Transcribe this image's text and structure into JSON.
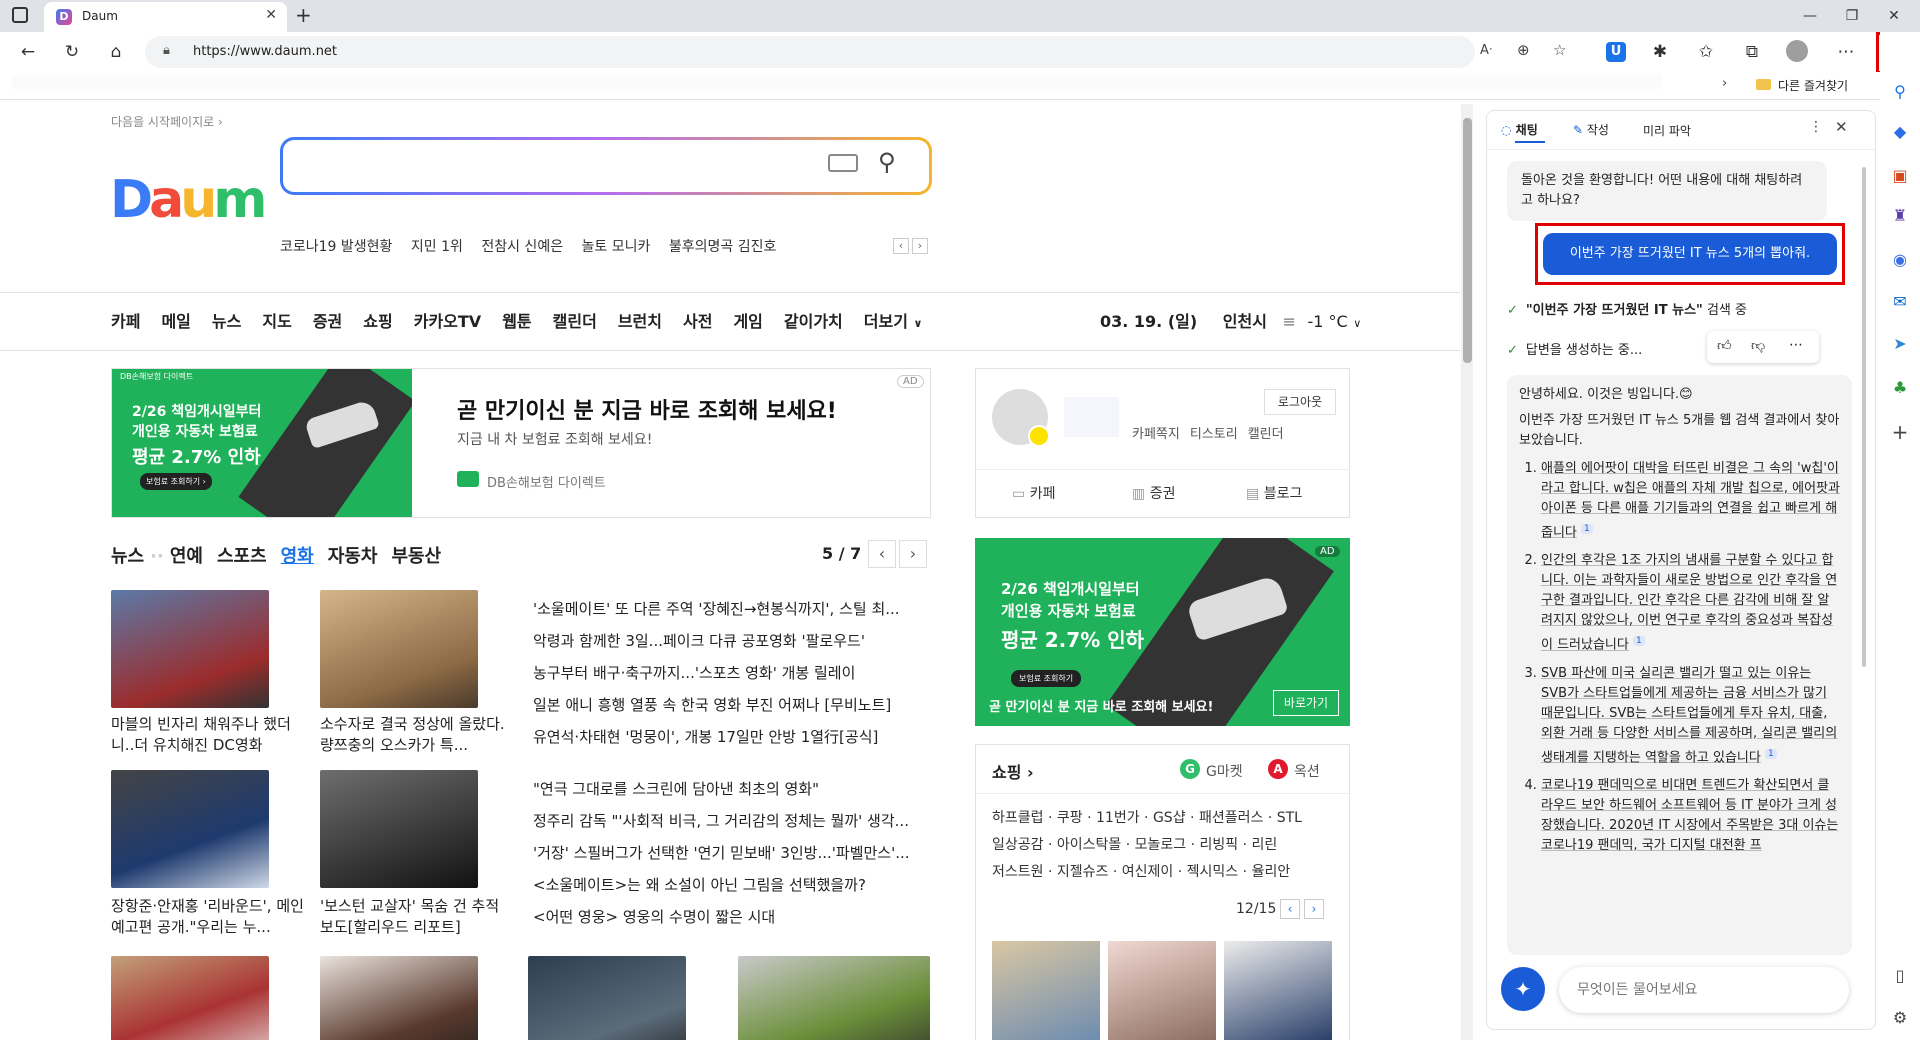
{
  "browser": {
    "tab_title": "Daum",
    "tab_icon": "D",
    "url": "https://www.daum.net",
    "fav_folder": "다른 즐겨찾기",
    "reading_icon": "Ȃ"
  },
  "daum": {
    "start_page": "다음을 시작페이지로",
    "logo": [
      "D",
      "a",
      "u",
      "m"
    ],
    "trending": [
      "코로나19 발생현황",
      "지민 1위",
      "전참시 신예은",
      "놀토 모니카",
      "불후의명곡 김진호"
    ],
    "nav": [
      "카페",
      "메일",
      "뉴스",
      "지도",
      "증권",
      "쇼핑",
      "카카오TV",
      "웹툰",
      "캘린더",
      "브런치",
      "사전",
      "게임",
      "같이가치",
      "더보기"
    ],
    "date": "03. 19. (일)",
    "location": "인천시",
    "temp": "-1 °C",
    "ad_main": {
      "badge": "AD",
      "headline": "곧 만기이신 분 지금 바로 조회해 보세요!",
      "sub": "지금 내 차 보험료 조회해 보세요!",
      "advertiser": "DB손해보험 다이렉트",
      "banner_top": "DB손해보험 다이렉트",
      "banner_line1": "2/26 책임개시일부터",
      "banner_line2": "개인용 자동차 보험료",
      "banner_line3": "평균 2.7% 인하",
      "banner_cta": "보험료 조회하기 ›"
    },
    "news_tabs": [
      "뉴스",
      "연예",
      "스포츠",
      "영화",
      "자동차",
      "부동산"
    ],
    "news_page": "5 / 7",
    "news_captions": [
      "마블의 빈자리 채워주나 했더니..더 유치해진 DC영화",
      "소수자로 결국 정상에 올랐다. 량쯔충의 오스카가 특...",
      "장항준·안재홍 '리바운드', 메인 예고편 공개.\"우리는 누...",
      "'보스턴 교살자' 목숨 건 추적 보도[할리우드 리포트]"
    ],
    "headlines_a": [
      "'소울메이트' 또 다른 주역 '장혜진→현봉식까지', 스틸 최...",
      "악령과 함께한 3일...페이크 다큐 공포영화 '팔로우드'",
      "농구부터 배구·축구까지...'스포츠 영화' 개봉 릴레이",
      "일본 애니 흥행 열풍 속 한국 영화 부진 어쩌나 [무비노트]",
      "유연석·차태현 '멍뭉이', 개봉 17일만 안방 1열行[공식]"
    ],
    "headlines_b": [
      "\"연극 그대로를 스크린에 담아낸 최초의 영화\"",
      "정주리 감독 \"'사회적 비극, 그 거리감의 정체는 뭘까' 생각...",
      "'거장' 스필버그가 선택한 '연기 믿보배' 3인방...'파벨만스'...",
      "<소울메이트>는 왜 소설이 아닌  그림을 선택했을까?",
      "<어떤 영웅> 영웅의 수명이 짧은 시대"
    ],
    "profile": {
      "logout": "로그아웃",
      "links": [
        "카페쪽지",
        "티스토리",
        "캘린더"
      ],
      "quick": [
        "카페",
        "증권",
        "블로그"
      ]
    },
    "ad_side": {
      "badge": "AD",
      "line1": "2/26 책임개시일부터",
      "line2": "개인용 자동차 보험료",
      "line3": "평균 2.7% 인하",
      "cta_small": "보험료 조회하기",
      "headline": "곧 만기이신 분 지금 바로 조회해 보세요!",
      "go": "바로가기"
    },
    "shopping": {
      "title": "쇼핑",
      "gmarket": "G마켓",
      "auction": "옥션",
      "rows": [
        [
          "하프클럽",
          "쿠팡",
          "11번가",
          "GS샵",
          "패션플러스",
          "STL"
        ],
        [
          "일상공감",
          "아이스탁몰",
          "모놀로그",
          "리빙픽",
          "리린"
        ],
        [
          "저스트원",
          "지젤슈즈",
          "여신제이",
          "젝시믹스",
          "율리안"
        ]
      ],
      "page": "12/15"
    }
  },
  "copilot": {
    "tabs": [
      "채팅",
      "작성",
      "미리 파악"
    ],
    "greeting": "돌아온 것을 환영합니다! 어떤 내용에 대해 채팅하려고 하나요?",
    "user_msg": "이번주 가장 뜨거웠던 IT 뉴스 5개의 뽑아줘.",
    "status1_bold": "\"이번주 가장 뜨거웠던 IT 뉴스\"",
    "status1_rest": " 검색 중",
    "status2": "답변을 생성하는 중...",
    "answer_intro1": "안녕하세요. 이것은 빙입니다.😊",
    "answer_intro2": "이번주 가장 뜨거웠던 IT 뉴스 5개를 웹 검색 결과에서 찾아보았습니다.",
    "items": [
      "애플의 에어팟이 대박을 터뜨린 비결은 그 속의 'w칩'이라고 합니다. w칩은 애플의 자체 개발 칩으로, 에어팟과 아이폰 등 다른 애플 기기들과의 연결을 쉽고 빠르게 해줍니다",
      "인간의 후각은 1조 가지의 냄새를 구분할 수 있다고 합니다. 이는 과학자들이 새로운 방법으로 인간 후각을 연구한 결과입니다. 인간 후각은 다른 감각에 비해 잘 알려지지 않았으나, 이번 연구로 후각의 중요성과 복잡성이 드러났습니다",
      "SVB 파산에 미국 실리콘 밸리가 떨고 있는 이유는 SVB가 스타트업들에게 제공하는 금융 서비스가 많기 때문입니다. SVB는 스타트업들에게 투자 유치, 대출, 외환 거래 등 다양한 서비스를 제공하며, 실리콘 밸리의 생태계를 지탱하는 역할을 하고 있습니다",
      "코로나19 팬데믹으로 비대면 트렌드가 확산되면서 클라우드 보안 하드웨어 소프트웨어 등 IT 분야가 크게 성장했습니다. 2020년 IT 시장에서 주목받은 3대 이슈는 코로나19 팬데믹, 국가 디지털 대전환 프"
    ],
    "cite": "1",
    "input_placeholder": "무엇이든 물어보세요"
  },
  "colors": {
    "accent_blue": "#1a5cd8",
    "daum_blue": "#3b7bf6",
    "daum_red": "#f24b3b",
    "daum_yellow": "#f5b52d",
    "daum_green": "#2fbf6b",
    "highlight_red": "#e00000",
    "db_green": "#1fb25a"
  }
}
